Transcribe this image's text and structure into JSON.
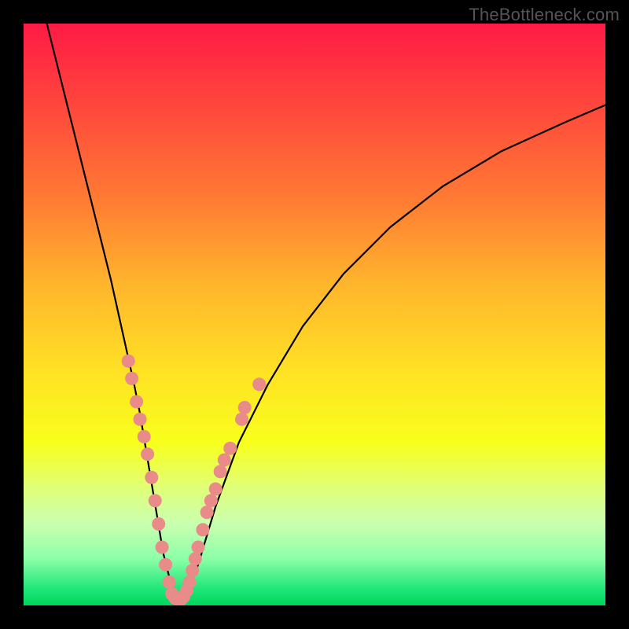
{
  "watermark": "TheBottleneck.com",
  "chart_data": {
    "type": "line",
    "title": "",
    "xlabel": "",
    "ylabel": "",
    "xlim": [
      0,
      100
    ],
    "ylim": [
      0,
      100
    ],
    "background_gradient": {
      "top": "#ff1a44",
      "middle": "#ffe224",
      "bottom": "#00d65c"
    },
    "series": [
      {
        "name": "bottleneck-curve",
        "color": "#000000",
        "x": [
          4,
          5,
          7,
          9,
          11,
          13,
          15,
          17,
          19,
          20,
          21,
          22,
          23,
          24,
          25,
          26,
          27,
          28,
          30,
          33,
          37,
          42,
          48,
          55,
          63,
          72,
          82,
          93,
          100
        ],
        "y": [
          100,
          96,
          88,
          80,
          72,
          64,
          56,
          47,
          38,
          33,
          27,
          21,
          15,
          9,
          5,
          2,
          1,
          2,
          7,
          17,
          28,
          38,
          48,
          57,
          65,
          72,
          78,
          83,
          86
        ]
      }
    ],
    "markers": [
      {
        "name": "left-cluster-dots",
        "color": "#e98b88",
        "shape": "circle",
        "points": [
          {
            "x": 18.0,
            "y": 42
          },
          {
            "x": 18.6,
            "y": 39
          },
          {
            "x": 19.4,
            "y": 35
          },
          {
            "x": 20.0,
            "y": 32
          },
          {
            "x": 20.7,
            "y": 29
          },
          {
            "x": 21.3,
            "y": 26
          },
          {
            "x": 22.0,
            "y": 22
          },
          {
            "x": 22.6,
            "y": 18
          },
          {
            "x": 23.2,
            "y": 14
          },
          {
            "x": 23.8,
            "y": 10
          },
          {
            "x": 24.4,
            "y": 7
          },
          {
            "x": 25.0,
            "y": 4
          }
        ]
      },
      {
        "name": "bottom-cluster-dots",
        "color": "#e98b88",
        "shape": "circle",
        "points": [
          {
            "x": 25.5,
            "y": 2.0
          },
          {
            "x": 26.0,
            "y": 1.3
          },
          {
            "x": 26.5,
            "y": 1.0
          },
          {
            "x": 27.0,
            "y": 1.0
          },
          {
            "x": 27.5,
            "y": 1.5
          },
          {
            "x": 28.0,
            "y": 2.5
          }
        ]
      },
      {
        "name": "right-cluster-dots",
        "color": "#e98b88",
        "shape": "circle",
        "points": [
          {
            "x": 28.5,
            "y": 4
          },
          {
            "x": 29.0,
            "y": 6
          },
          {
            "x": 29.5,
            "y": 8
          },
          {
            "x": 30.0,
            "y": 10
          },
          {
            "x": 30.8,
            "y": 13
          },
          {
            "x": 31.5,
            "y": 16
          },
          {
            "x": 32.2,
            "y": 18
          },
          {
            "x": 33.0,
            "y": 20
          },
          {
            "x": 33.8,
            "y": 23
          },
          {
            "x": 34.5,
            "y": 25
          },
          {
            "x": 35.5,
            "y": 27
          },
          {
            "x": 37.5,
            "y": 32
          },
          {
            "x": 38.0,
            "y": 34
          },
          {
            "x": 40.5,
            "y": 38
          }
        ]
      }
    ]
  }
}
